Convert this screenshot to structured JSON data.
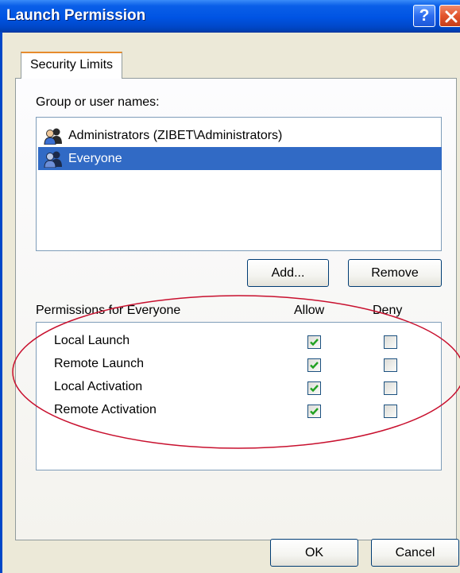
{
  "window": {
    "title": "Launch Permission",
    "help_label": "?"
  },
  "tabs": [
    {
      "label": "Security Limits",
      "selected": true
    }
  ],
  "users_section": {
    "label": "Group or user names:",
    "items": [
      {
        "label": "Administrators (ZIBET\\Administrators)",
        "selected": false,
        "icon": "user-group-icon"
      },
      {
        "label": "Everyone",
        "selected": true,
        "icon": "user-group-icon"
      }
    ],
    "add_label": "Add...",
    "remove_label": "Remove"
  },
  "permissions": {
    "header_label": "Permissions for Everyone",
    "allow_label": "Allow",
    "deny_label": "Deny",
    "rows": [
      {
        "name": "Local Launch",
        "allow": true,
        "deny": false
      },
      {
        "name": "Remote Launch",
        "allow": true,
        "deny": false
      },
      {
        "name": "Local Activation",
        "allow": true,
        "deny": false
      },
      {
        "name": "Remote Activation",
        "allow": true,
        "deny": false
      }
    ]
  },
  "footer": {
    "ok_label": "OK",
    "cancel_label": "Cancel"
  },
  "colors": {
    "titlebar": "#0054e3",
    "selection": "#316ac5",
    "check": "#21a121",
    "annotation": "#c8102e",
    "tab_highlight": "#e68b2c"
  }
}
